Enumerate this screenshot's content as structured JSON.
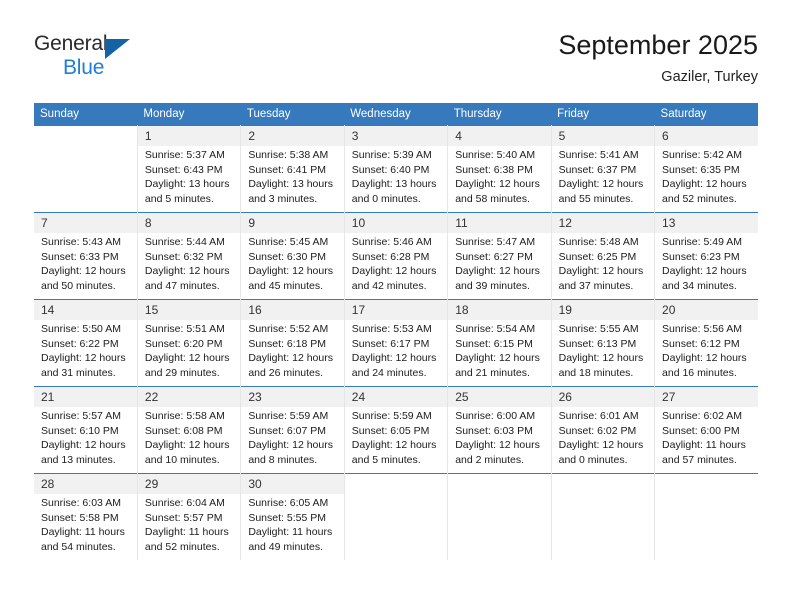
{
  "brand": {
    "name_top": "General",
    "name_bottom": "Blue",
    "triangle_icon": "triangle-logo-icon",
    "accent_color": "#1f7fd4",
    "logo_dark_color": "#2a2a2a"
  },
  "header": {
    "title": "September 2025",
    "subtitle": "Gaziler, Turkey",
    "header_bg_color": "#3679bc",
    "header_text_color": "#ffffff",
    "daynum_bg_color": "#f1f1f1"
  },
  "weekday_headers": [
    "Sunday",
    "Monday",
    "Tuesday",
    "Wednesday",
    "Thursday",
    "Friday",
    "Saturday"
  ],
  "weeks": [
    [
      {
        "day": "",
        "lines": [
          "",
          "",
          "",
          ""
        ]
      },
      {
        "day": "1",
        "lines": [
          "Sunrise: 5:37 AM",
          "Sunset: 6:43 PM",
          "Daylight: 13 hours",
          "and 5 minutes."
        ]
      },
      {
        "day": "2",
        "lines": [
          "Sunrise: 5:38 AM",
          "Sunset: 6:41 PM",
          "Daylight: 13 hours",
          "and 3 minutes."
        ]
      },
      {
        "day": "3",
        "lines": [
          "Sunrise: 5:39 AM",
          "Sunset: 6:40 PM",
          "Daylight: 13 hours",
          "and 0 minutes."
        ]
      },
      {
        "day": "4",
        "lines": [
          "Sunrise: 5:40 AM",
          "Sunset: 6:38 PM",
          "Daylight: 12 hours",
          "and 58 minutes."
        ]
      },
      {
        "day": "5",
        "lines": [
          "Sunrise: 5:41 AM",
          "Sunset: 6:37 PM",
          "Daylight: 12 hours",
          "and 55 minutes."
        ]
      },
      {
        "day": "6",
        "lines": [
          "Sunrise: 5:42 AM",
          "Sunset: 6:35 PM",
          "Daylight: 12 hours",
          "and 52 minutes."
        ]
      }
    ],
    [
      {
        "day": "7",
        "lines": [
          "Sunrise: 5:43 AM",
          "Sunset: 6:33 PM",
          "Daylight: 12 hours",
          "and 50 minutes."
        ]
      },
      {
        "day": "8",
        "lines": [
          "Sunrise: 5:44 AM",
          "Sunset: 6:32 PM",
          "Daylight: 12 hours",
          "and 47 minutes."
        ]
      },
      {
        "day": "9",
        "lines": [
          "Sunrise: 5:45 AM",
          "Sunset: 6:30 PM",
          "Daylight: 12 hours",
          "and 45 minutes."
        ]
      },
      {
        "day": "10",
        "lines": [
          "Sunrise: 5:46 AM",
          "Sunset: 6:28 PM",
          "Daylight: 12 hours",
          "and 42 minutes."
        ]
      },
      {
        "day": "11",
        "lines": [
          "Sunrise: 5:47 AM",
          "Sunset: 6:27 PM",
          "Daylight: 12 hours",
          "and 39 minutes."
        ]
      },
      {
        "day": "12",
        "lines": [
          "Sunrise: 5:48 AM",
          "Sunset: 6:25 PM",
          "Daylight: 12 hours",
          "and 37 minutes."
        ]
      },
      {
        "day": "13",
        "lines": [
          "Sunrise: 5:49 AM",
          "Sunset: 6:23 PM",
          "Daylight: 12 hours",
          "and 34 minutes."
        ]
      }
    ],
    [
      {
        "day": "14",
        "lines": [
          "Sunrise: 5:50 AM",
          "Sunset: 6:22 PM",
          "Daylight: 12 hours",
          "and 31 minutes."
        ]
      },
      {
        "day": "15",
        "lines": [
          "Sunrise: 5:51 AM",
          "Sunset: 6:20 PM",
          "Daylight: 12 hours",
          "and 29 minutes."
        ]
      },
      {
        "day": "16",
        "lines": [
          "Sunrise: 5:52 AM",
          "Sunset: 6:18 PM",
          "Daylight: 12 hours",
          "and 26 minutes."
        ]
      },
      {
        "day": "17",
        "lines": [
          "Sunrise: 5:53 AM",
          "Sunset: 6:17 PM",
          "Daylight: 12 hours",
          "and 24 minutes."
        ]
      },
      {
        "day": "18",
        "lines": [
          "Sunrise: 5:54 AM",
          "Sunset: 6:15 PM",
          "Daylight: 12 hours",
          "and 21 minutes."
        ]
      },
      {
        "day": "19",
        "lines": [
          "Sunrise: 5:55 AM",
          "Sunset: 6:13 PM",
          "Daylight: 12 hours",
          "and 18 minutes."
        ]
      },
      {
        "day": "20",
        "lines": [
          "Sunrise: 5:56 AM",
          "Sunset: 6:12 PM",
          "Daylight: 12 hours",
          "and 16 minutes."
        ]
      }
    ],
    [
      {
        "day": "21",
        "lines": [
          "Sunrise: 5:57 AM",
          "Sunset: 6:10 PM",
          "Daylight: 12 hours",
          "and 13 minutes."
        ]
      },
      {
        "day": "22",
        "lines": [
          "Sunrise: 5:58 AM",
          "Sunset: 6:08 PM",
          "Daylight: 12 hours",
          "and 10 minutes."
        ]
      },
      {
        "day": "23",
        "lines": [
          "Sunrise: 5:59 AM",
          "Sunset: 6:07 PM",
          "Daylight: 12 hours",
          "and 8 minutes."
        ]
      },
      {
        "day": "24",
        "lines": [
          "Sunrise: 5:59 AM",
          "Sunset: 6:05 PM",
          "Daylight: 12 hours",
          "and 5 minutes."
        ]
      },
      {
        "day": "25",
        "lines": [
          "Sunrise: 6:00 AM",
          "Sunset: 6:03 PM",
          "Daylight: 12 hours",
          "and 2 minutes."
        ]
      },
      {
        "day": "26",
        "lines": [
          "Sunrise: 6:01 AM",
          "Sunset: 6:02 PM",
          "Daylight: 12 hours",
          "and 0 minutes."
        ]
      },
      {
        "day": "27",
        "lines": [
          "Sunrise: 6:02 AM",
          "Sunset: 6:00 PM",
          "Daylight: 11 hours",
          "and 57 minutes."
        ]
      }
    ],
    [
      {
        "day": "28",
        "lines": [
          "Sunrise: 6:03 AM",
          "Sunset: 5:58 PM",
          "Daylight: 11 hours",
          "and 54 minutes."
        ]
      },
      {
        "day": "29",
        "lines": [
          "Sunrise: 6:04 AM",
          "Sunset: 5:57 PM",
          "Daylight: 11 hours",
          "and 52 minutes."
        ]
      },
      {
        "day": "30",
        "lines": [
          "Sunrise: 6:05 AM",
          "Sunset: 5:55 PM",
          "Daylight: 11 hours",
          "and 49 minutes."
        ]
      },
      {
        "day": "",
        "lines": [
          "",
          "",
          "",
          ""
        ]
      },
      {
        "day": "",
        "lines": [
          "",
          "",
          "",
          ""
        ]
      },
      {
        "day": "",
        "lines": [
          "",
          "",
          "",
          ""
        ]
      },
      {
        "day": "",
        "lines": [
          "",
          "",
          "",
          ""
        ]
      }
    ]
  ]
}
